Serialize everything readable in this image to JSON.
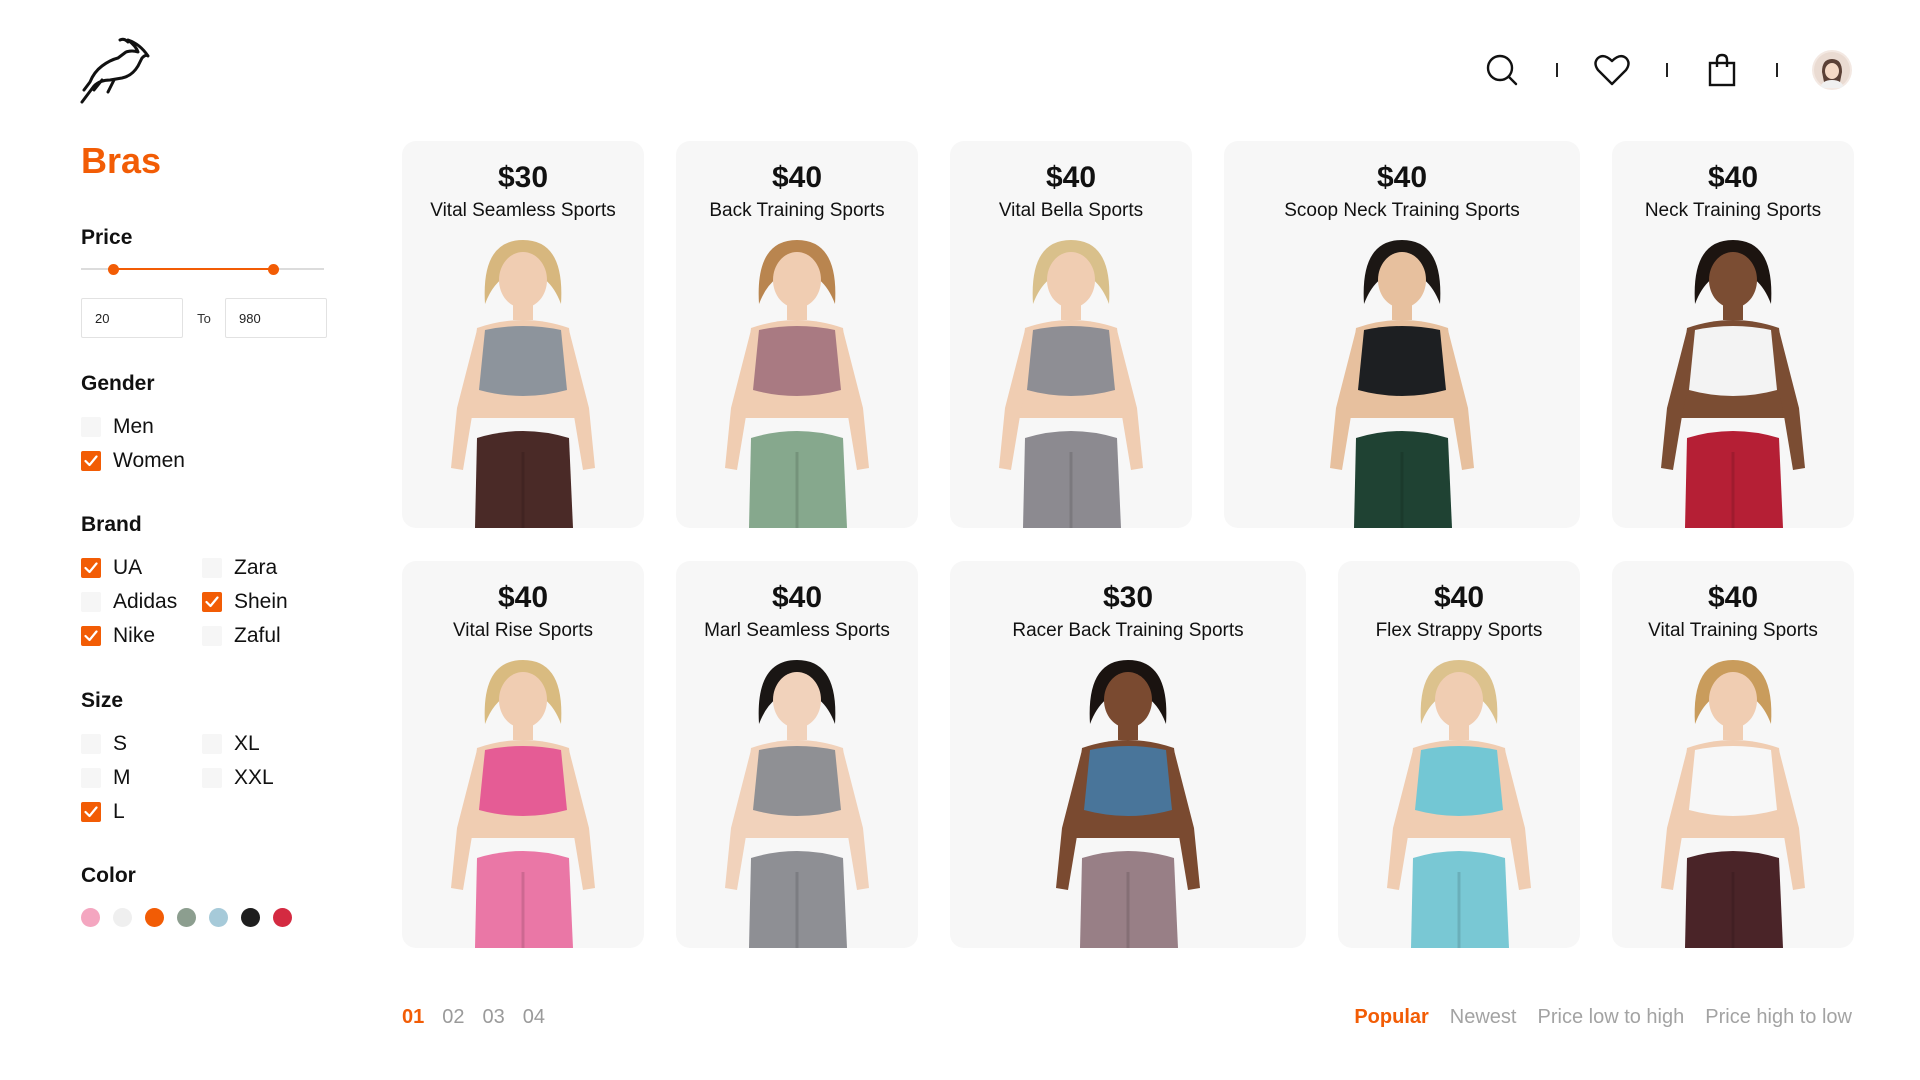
{
  "header": {
    "logo_icon": "gazelle-logo",
    "icons": [
      "search-icon",
      "heart-icon",
      "shopping-bag-icon",
      "user-avatar"
    ]
  },
  "filters": {
    "category_title": "Bras",
    "price": {
      "title": "Price",
      "range_low_fraction": 0.13,
      "range_high_fraction": 0.79,
      "min_value": "20",
      "to_label": "To",
      "max_value": "980"
    },
    "gender": {
      "title": "Gender",
      "options": [
        {
          "label": "Men",
          "checked": false
        },
        {
          "label": "Women",
          "checked": true
        }
      ]
    },
    "brand": {
      "title": "Brand",
      "options": [
        {
          "label": "UA",
          "checked": true
        },
        {
          "label": "Zara",
          "checked": false
        },
        {
          "label": "Adidas",
          "checked": false
        },
        {
          "label": "Shein",
          "checked": true
        },
        {
          "label": "Nike",
          "checked": true
        },
        {
          "label": "Zaful",
          "checked": false
        }
      ]
    },
    "size": {
      "title": "Size",
      "options": [
        {
          "label": "S",
          "checked": false
        },
        {
          "label": "XL",
          "checked": false
        },
        {
          "label": "M",
          "checked": false
        },
        {
          "label": "XXL",
          "checked": false
        },
        {
          "label": "L",
          "checked": true
        }
      ]
    },
    "color": {
      "title": "Color",
      "swatches": [
        "#f4a6c0",
        "#efefef",
        "#f25c05",
        "#8c9e8f",
        "#a6cad9",
        "#1e1e1e",
        "#d42a41"
      ]
    }
  },
  "products": [
    {
      "price": "$30",
      "name": "Vital Seamless Sports",
      "top": "#8d949c",
      "bottom": "#4a2a27",
      "skin": "#f0cdb2",
      "hair": "#d7b77e"
    },
    {
      "price": "$40",
      "name": "Back Training Sports",
      "top": "#a97a82",
      "bottom": "#86a88d",
      "skin": "#f0cdb2",
      "hair": "#b9854f"
    },
    {
      "price": "$40",
      "name": "Vital Bella Sports",
      "top": "#8e8e94",
      "bottom": "#8c8a90",
      "skin": "#f0cdb2",
      "hair": "#d9c08b"
    },
    {
      "price": "$40",
      "name": "Scoop Neck Training Sports",
      "top": "#1d1f22",
      "bottom": "#1f4233",
      "skin": "#e7c09e",
      "hair": "#1c1714"
    },
    {
      "price": "$40",
      "name": "Neck Training Sports",
      "top": "#f3f3f3",
      "bottom": "#b51f35",
      "skin": "#7b4d33",
      "hair": "#1c1410"
    },
    {
      "price": "$40",
      "name": "Vital Rise Sports",
      "top": "#e55c95",
      "bottom": "#ea77a6",
      "skin": "#f0cdb2",
      "hair": "#d9bb80"
    },
    {
      "price": "$40",
      "name": "Marl Seamless Sports",
      "top": "#8f9094",
      "bottom": "#8e8f94",
      "skin": "#f1d2bb",
      "hair": "#1a1614"
    },
    {
      "price": "$30",
      "name": "Racer Back Training Sports",
      "top": "#49759a",
      "bottom": "#987f86",
      "skin": "#7a4a30",
      "hair": "#1a1310"
    },
    {
      "price": "$40",
      "name": "Flex Strappy Sports",
      "top": "#73c7d4",
      "bottom": "#79c8d4",
      "skin": "#f0cdb2",
      "hair": "#dcc28d"
    },
    {
      "price": "$40",
      "name": "Vital Training Sports",
      "top": "#f7f7f7",
      "bottom": "#4a2428",
      "skin": "#f0cdb2",
      "hair": "#c99c5c"
    }
  ],
  "pagination": [
    "01",
    "02",
    "03",
    "04"
  ],
  "pagination_active": "01",
  "sort": {
    "options": [
      "Popular",
      "Newest",
      "Price low to high",
      "Price high to low"
    ],
    "active": "Popular"
  }
}
